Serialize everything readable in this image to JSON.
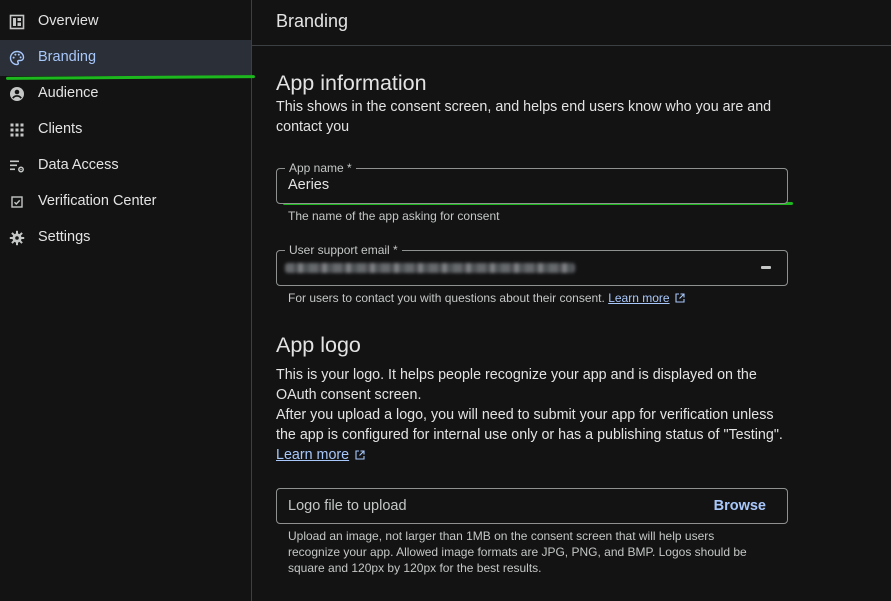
{
  "sidebar": {
    "items": [
      {
        "label": "Overview",
        "icon": "dashboard-icon"
      },
      {
        "label": "Branding",
        "icon": "palette-icon",
        "active": true
      },
      {
        "label": "Audience",
        "icon": "account-circle-icon"
      },
      {
        "label": "Clients",
        "icon": "apps-grid-icon"
      },
      {
        "label": "Data Access",
        "icon": "data-settings-icon"
      },
      {
        "label": "Verification Center",
        "icon": "verified-checkbox-icon"
      },
      {
        "label": "Settings",
        "icon": "gear-icon"
      }
    ]
  },
  "header": {
    "title": "Branding"
  },
  "app_info": {
    "heading": "App information",
    "description": "This shows in the consent screen, and helps end users know who you are and contact you",
    "app_name": {
      "label": "App name *",
      "value": "Aeries",
      "hint": "The name of the app asking for consent"
    },
    "support_email": {
      "label": "User support email *",
      "hint": "For users to contact you with questions about their consent.",
      "learn_more": "Learn more"
    }
  },
  "app_logo": {
    "heading": "App logo",
    "description_1": "This is your logo. It helps people recognize your app and is displayed on the OAuth consent screen.",
    "description_2": "After you upload a logo, you will need to submit your app for verification unless the app is configured for internal use only or has a publishing status of \"Testing\".",
    "learn_more": "Learn more",
    "upload_placeholder": "Logo file to upload",
    "browse_label": "Browse",
    "hint_1": "Upload an image, not larger than 1MB on the consent screen that will help users",
    "hint_2": "recognize your app. Allowed image formats are JPG, PNG, and BMP. Logos should be",
    "hint_3": "square and 120px by 120px for the best results."
  },
  "colors": {
    "background": "#131314",
    "accent": "#a8c7fa",
    "active_bg": "#2a2f38",
    "annotation": "#1db81d"
  }
}
